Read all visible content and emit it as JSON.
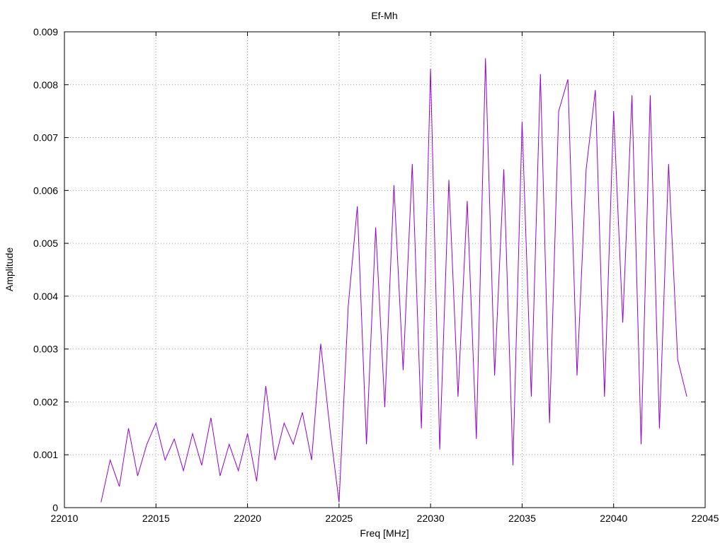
{
  "chart_data": {
    "type": "line",
    "title": "Ef-Mh",
    "xlabel": "Freq [MHz]",
    "ylabel": "Amplitude",
    "xlim": [
      22010,
      22045
    ],
    "ylim": [
      0,
      0.009
    ],
    "x_ticks": [
      22010,
      22015,
      22020,
      22025,
      22030,
      22035,
      22040,
      22045
    ],
    "x_tick_labels": [
      "22010",
      "22015",
      "22020",
      "22025",
      "22030",
      "22035",
      "22040",
      "22045"
    ],
    "y_ticks": [
      0,
      0.001,
      0.002,
      0.003,
      0.004,
      0.005,
      0.006,
      0.007,
      0.008,
      0.009
    ],
    "y_tick_labels": [
      "0",
      "0.001",
      "0.002",
      "0.003",
      "0.004",
      "0.005",
      "0.006",
      "0.007",
      "0.008",
      "0.009"
    ],
    "grid": true,
    "line_color": "#9400d3",
    "series": [
      {
        "x": [
          22012.0,
          22012.5,
          22013.0,
          22013.5,
          22014.0,
          22014.5,
          22015.0,
          22015.5,
          22016.0,
          22016.5,
          22017.0,
          22017.5,
          22018.0,
          22018.5,
          22019.0,
          22019.5,
          22020.0,
          22020.5,
          22021.0,
          22021.5,
          22022.0,
          22022.5,
          22023.0,
          22023.5,
          22024.0,
          22024.5,
          22025.0,
          22025.5,
          22026.0,
          22026.5,
          22027.0,
          22027.5,
          22028.0,
          22028.5,
          22029.0,
          22029.5,
          22030.0,
          22030.5,
          22031.0,
          22031.5,
          22032.0,
          22032.5,
          22033.0,
          22033.5,
          22034.0,
          22034.5,
          22035.0,
          22035.5,
          22036.0,
          22036.5,
          22037.0,
          22037.5,
          22038.0,
          22038.5,
          22039.0,
          22039.5,
          22040.0,
          22040.5,
          22041.0,
          22041.5,
          22042.0,
          22042.5,
          22043.0,
          22043.5,
          22044.0
        ],
        "y": [
          0.0001,
          0.0009,
          0.0004,
          0.0015,
          0.0006,
          0.0012,
          0.0016,
          0.0009,
          0.0013,
          0.0007,
          0.0014,
          0.0008,
          0.0017,
          0.0006,
          0.0012,
          0.0007,
          0.0014,
          0.0005,
          0.0023,
          0.0009,
          0.0016,
          0.0012,
          0.0018,
          0.0009,
          0.0031,
          0.0015,
          0.0001,
          0.0038,
          0.0057,
          0.0012,
          0.0053,
          0.0019,
          0.0061,
          0.0026,
          0.0065,
          0.0015,
          0.0083,
          0.0011,
          0.0062,
          0.0021,
          0.0058,
          0.0013,
          0.0085,
          0.0025,
          0.0064,
          0.0008,
          0.0073,
          0.0021,
          0.0082,
          0.0016,
          0.0075,
          0.0081,
          0.0025,
          0.0064,
          0.0079,
          0.0021,
          0.0075,
          0.0035,
          0.0078,
          0.0012,
          0.0078,
          0.0015,
          0.0065,
          0.0028,
          0.0021
        ]
      }
    ]
  }
}
